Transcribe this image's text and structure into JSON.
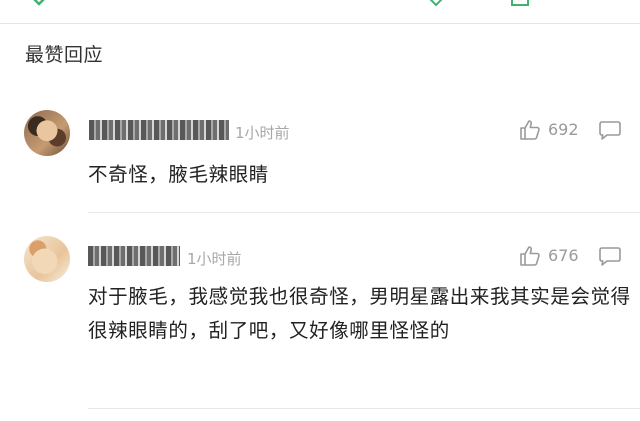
{
  "section_title": "最赞回应",
  "comments": [
    {
      "time": "1小时前",
      "likes": "692",
      "text": "不奇怪，腋毛辣眼睛"
    },
    {
      "time": "1小时前",
      "likes": "676",
      "text": "对于腋毛，我感觉我也很奇怪，男明星露出来我其实是会觉得很辣眼睛的，刮了吧，又好像哪里怪怪的"
    }
  ],
  "icons": {
    "like": "thumbs-up-icon",
    "reply": "comment-bubble-icon"
  },
  "colors": {
    "muted_text": "#a8a8a8",
    "divider": "#e8e8e8",
    "icon_stroke": "#9a9a9a"
  }
}
